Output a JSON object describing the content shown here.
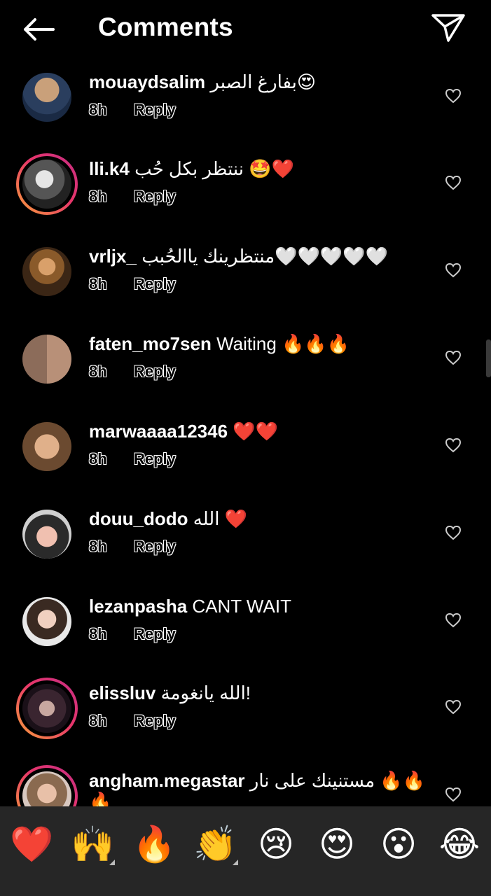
{
  "header": {
    "title": "Comments"
  },
  "comments": [
    {
      "username": "mouaydsalim",
      "text": "بفارغ الصبر😍",
      "time": "8h",
      "reply": "Reply"
    },
    {
      "username": "lli.k4",
      "text": "ننتظر بكل حُب 🤩❤️",
      "time": "8h",
      "reply": "Reply"
    },
    {
      "username": "vrljx_",
      "text": "منتظرينك ياالحُبب🤍🤍🤍🤍🤍",
      "time": "8h",
      "reply": "Reply"
    },
    {
      "username": "faten_mo7sen",
      "text": "Waiting 🔥🔥🔥",
      "time": "8h",
      "reply": "Reply"
    },
    {
      "username": "marwaaaa12346",
      "text": "❤️❤️",
      "time": "8h",
      "reply": "Reply"
    },
    {
      "username": "douu_dodo",
      "text": "الله ❤️",
      "time": "8h",
      "reply": "Reply"
    },
    {
      "username": "lezanpasha",
      "text": "CANT WAIT",
      "time": "8h",
      "reply": "Reply"
    },
    {
      "username": "elissluv",
      "text": "الله يانغومة!",
      "time": "8h",
      "reply": "Reply"
    },
    {
      "username": "angham.megastar",
      "text": "مستنينك على نار 🔥🔥",
      "text2": "🔥",
      "time": "",
      "reply": ""
    }
  ],
  "emoji_bar": [
    "❤️",
    "🙌",
    "🔥",
    "👏",
    "😢",
    "😍",
    "😮",
    "😂"
  ],
  "colors": {
    "background": "#000000",
    "emoji_bar_bg": "#262626",
    "story_ring": "#e8366a"
  }
}
